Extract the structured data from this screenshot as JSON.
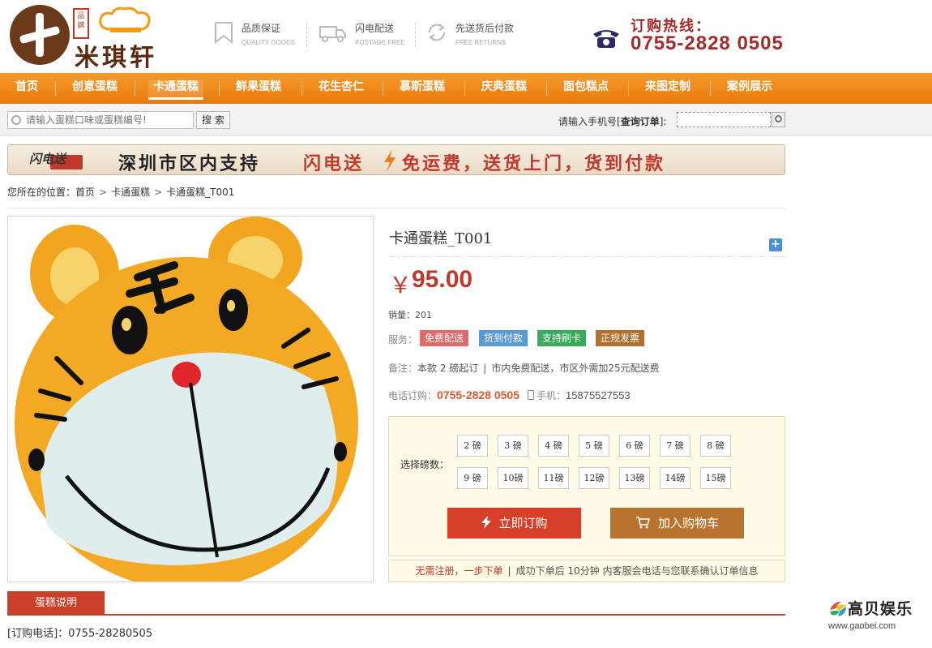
{
  "header": {
    "logo_text": "米琪轩",
    "logo_seal": "品牌",
    "features": [
      {
        "title": "品质保证",
        "subtitle": "QUALITY GOODS",
        "icon": "bookmark-icon"
      },
      {
        "title": "闪电配送",
        "subtitle": "POSTAGE FREE",
        "icon": "truck-icon"
      },
      {
        "title": "先送货后付款",
        "subtitle": "FREE RETURNS",
        "icon": "return-icon"
      }
    ],
    "hotline_label": "订购热线：",
    "hotline_number": "0755-2828 0505"
  },
  "nav": {
    "items": [
      "首页",
      "创意蛋糕",
      "卡通蛋糕",
      "鲜果蛋糕",
      "花生杏仁",
      "慕斯蛋糕",
      "庆典蛋糕",
      "面包糕点",
      "来图定制",
      "案例展示"
    ],
    "active": "卡通蛋糕"
  },
  "search": {
    "placeholder": "请输入蛋糕口味或蛋糕编号!",
    "button": "搜 索",
    "order_query_prefix": "请输入手机号[",
    "order_query_bold": "查询订单",
    "order_query_suffix": "]:"
  },
  "banner": {
    "logo": "闪电送",
    "text1": "深圳市区内支持",
    "text2": "闪电送",
    "text3": "免运费，送货上门，货到付款"
  },
  "breadcrumb": {
    "prefix": "您所在的位置：",
    "items": [
      "首页",
      "卡通蛋糕",
      "卡通蛋糕_T001"
    ]
  },
  "product": {
    "name": "卡通蛋糕_T001",
    "currency": "￥",
    "price": "95.00",
    "sales": "销量：201",
    "services_label": "服务：",
    "services": [
      {
        "label": "免费配送",
        "color": "#e06b6b"
      },
      {
        "label": "货到付款",
        "color": "#5b9bd5"
      },
      {
        "label": "支持刷卡",
        "color": "#3aaa5c"
      },
      {
        "label": "正规发票",
        "color": "#b0702f"
      }
    ],
    "note_label": "备注：",
    "note_1": "本款 2 磅起订",
    "note_2": "市内免费配送，市区外需加25元配送费",
    "tel_label": "电话订购：",
    "tel_number": "0755-2828 0505",
    "mobile_label": "手机：",
    "mobile_number": "15875527553",
    "weight_label": "选择磅数：",
    "weights": [
      "2 磅",
      "3 磅",
      "4 磅",
      "5 磅",
      "6 磅",
      "7 磅",
      "8 磅",
      "9 磅",
      "10磅",
      "11磅",
      "12磅",
      "13磅",
      "14磅",
      "15磅"
    ],
    "buy_now": "立即订购",
    "add_cart": "加入购物车",
    "notice_1": "无需注册，一步下单",
    "notice_2": "成功下单后 10分钟 内客服会电话与您联系确认订单信息"
  },
  "tabs": {
    "active": "蛋糕说明"
  },
  "footer_tel": "[订购电话]：0755-28280505",
  "watermark": {
    "text": "高贝娱乐",
    "url": "www.gaobei.com"
  },
  "colors": {
    "nav_orange": "#f08a1a",
    "price_red": "#c0392b",
    "buy_button": "#d6402b",
    "cart_button": "#b8742f",
    "tab_red": "#c9402b"
  }
}
